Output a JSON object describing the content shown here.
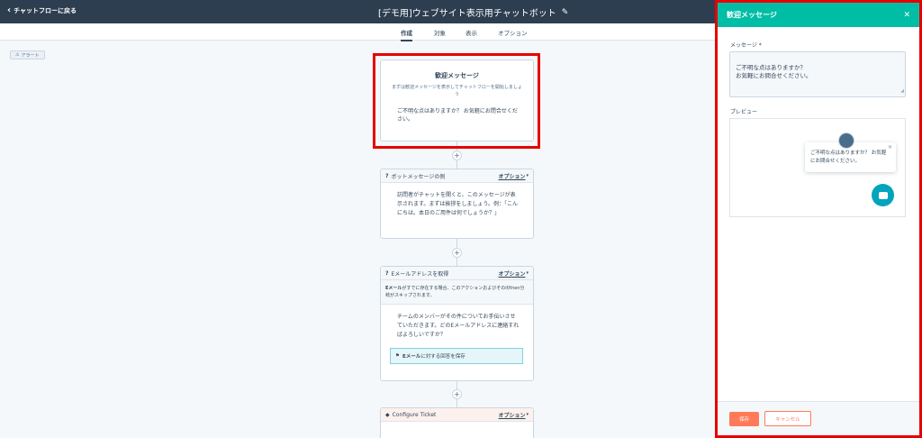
{
  "header": {
    "back_label": "チャットフローに戻る",
    "title": "[デモ用]ウェブサイト表示用チャットボット"
  },
  "tabs": [
    "作成",
    "対象",
    "表示",
    "オプション"
  ],
  "alert_tag": "アラート",
  "welcome_card": {
    "title": "歓迎メッセージ",
    "subtitle": "まずは歓迎メッセージを表示してチャットフローを開始しましょう",
    "message": "ご不明な点はありますか？ お気軽にお問合せください。"
  },
  "bot_card": {
    "name": "ボットメッセージの例",
    "option": "オプション",
    "body": "訪問者がチャットを開くと、このメッセージが表示されます。まずは挨拶をしましょう。例：「こんにちは。本日のご用件は何でしょうか？」"
  },
  "email_card": {
    "name": "Eメールアドレスを取得",
    "option": "オプション",
    "note_bold": "Eメール",
    "note_rest": "がすでに存在する場合、このアクションおよびそのif/then分岐がスキップされます。",
    "body": "チームのメンバーがその件についてお手伝いさせていただきます。どのEメールアドレスに連絡すればよろしいですか？",
    "save_bold": "Eメール",
    "save_rest": "に対する回答を保存"
  },
  "ticket_card": {
    "name": "Configure Ticket",
    "option": "オプション"
  },
  "panel": {
    "title": "歓迎メッセージ",
    "message_label": "メッセージ *",
    "message_value": "ご不明な点はありますか？\nお気軽にお問合せください。",
    "preview_label": "プレビュー",
    "preview_text": "ご不明な点はありますか？ お気軽にお問合せください。",
    "save_button": "保存",
    "cancel_button": "キャンセル"
  },
  "colors": {
    "header_bg": "#2d3e50",
    "panel_header_bg": "#00bda5",
    "highlight": "#e60000",
    "save_button": "#ff7a59",
    "chat_launcher": "#00a4bd"
  }
}
